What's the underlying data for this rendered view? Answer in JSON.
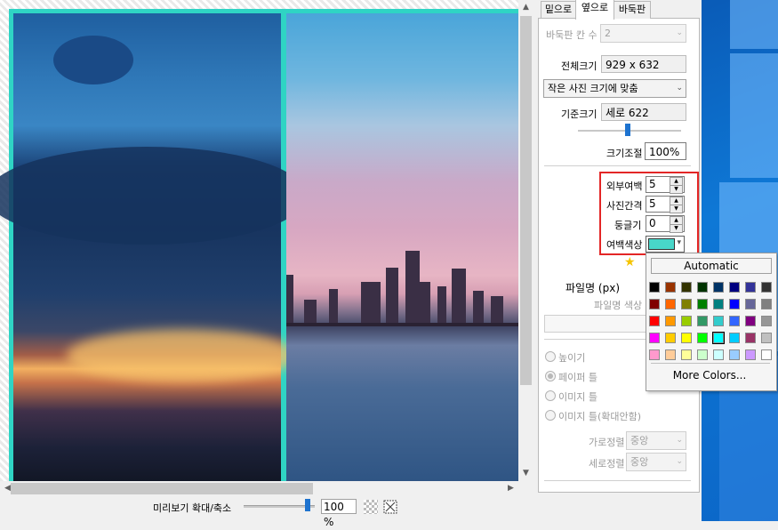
{
  "preview": {
    "zoom_label": "미리보기 확대/축소",
    "zoom_value": "100 %",
    "zoom_level": 0.9,
    "frame_color": "#2fd4c4"
  },
  "tabs": [
    {
      "label": "밑으로",
      "active": false
    },
    {
      "label": "옆으로",
      "active": true
    },
    {
      "label": "바둑판",
      "active": false
    }
  ],
  "panel": {
    "grid_count_label": "바둑판 칸 수",
    "grid_count_value": "2",
    "total_size_label": "전체크기",
    "total_size_value": "929 x 632",
    "fit_option": "작은 사진 크기에 맞춤",
    "base_size_label": "기준크기",
    "base_size_value": "세로 622",
    "scale_label": "크기조절",
    "scale_value": "100%",
    "outer_margin_label": "외부여백",
    "outer_margin_value": "5",
    "photo_gap_label": "사진간격",
    "photo_gap_value": "5",
    "roundness_label": "둥글기",
    "roundness_value": "0",
    "margin_color_label": "여백색상",
    "margin_color": "#48d6c9",
    "filename_label": "파일명 (px)",
    "filename_color_label": "파일명 색상",
    "radio_options": [
      {
        "label": "높이기",
        "checked": false
      },
      {
        "label": "페이퍼 틀",
        "checked": true
      },
      {
        "label": "이미지 틀",
        "checked": false
      },
      {
        "label": "이미지 틀(확대안함)",
        "checked": false
      }
    ],
    "h_align_label": "가로정렬",
    "h_align_value": "중앙",
    "v_align_label": "세로정렬",
    "v_align_value": "중앙"
  },
  "color_popup": {
    "automatic_label": "Automatic",
    "more_colors_label": "More Colors...",
    "selected_index": 28,
    "colors": [
      "#000000",
      "#993300",
      "#333300",
      "#003300",
      "#003366",
      "#000080",
      "#333399",
      "#333333",
      "#800000",
      "#ff6600",
      "#808000",
      "#008000",
      "#008080",
      "#0000ff",
      "#666699",
      "#808080",
      "#ff0000",
      "#ff9900",
      "#99cc00",
      "#339966",
      "#33cccc",
      "#3366ff",
      "#800080",
      "#969696",
      "#ff00ff",
      "#ffcc00",
      "#ffff00",
      "#00ff00",
      "#00ffff",
      "#00ccff",
      "#993366",
      "#c0c0c0",
      "#ff99cc",
      "#ffcc99",
      "#ffff99",
      "#ccffcc",
      "#ccffff",
      "#99ccff",
      "#cc99ff",
      "#ffffff"
    ]
  }
}
